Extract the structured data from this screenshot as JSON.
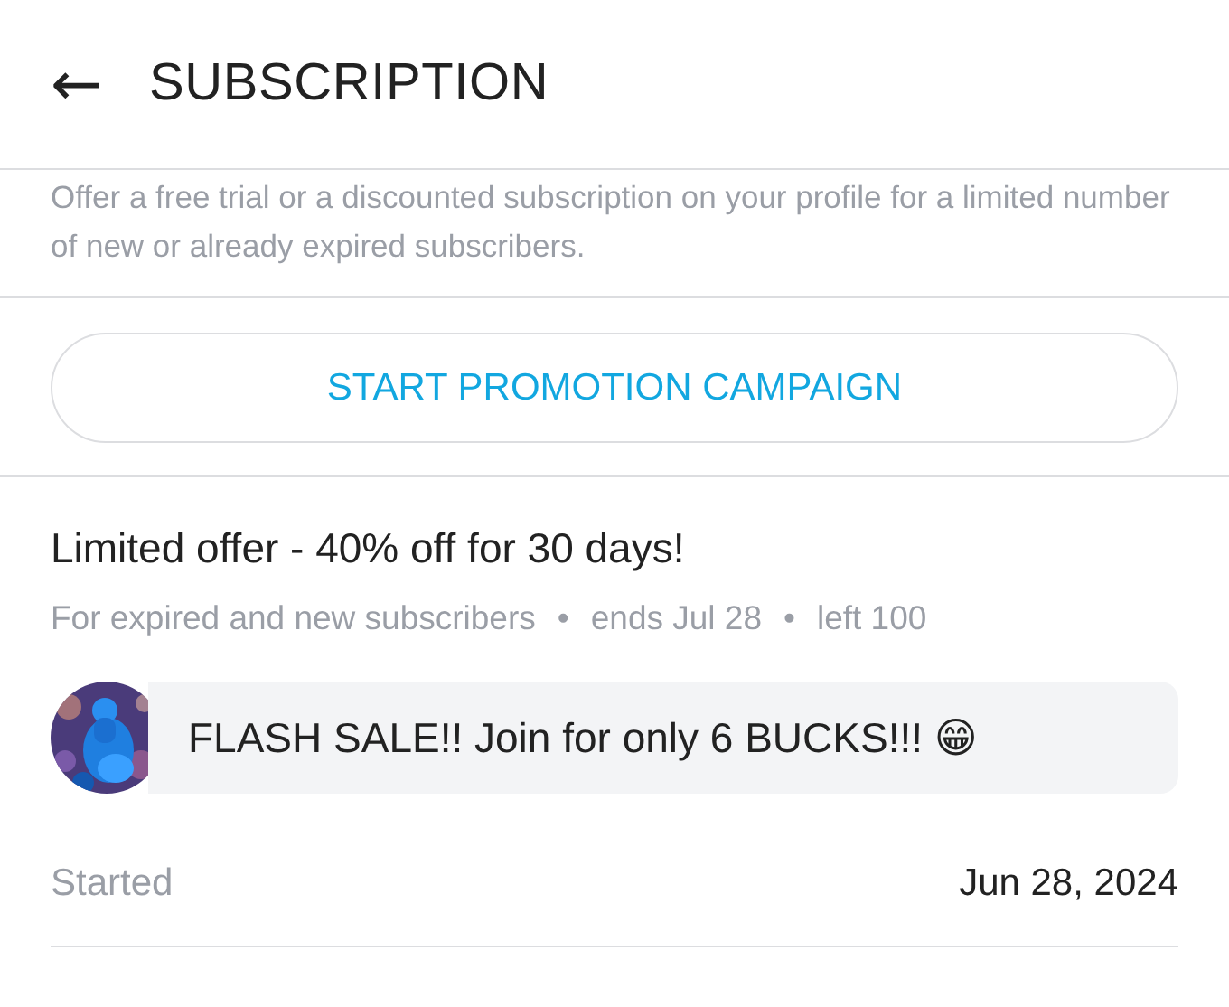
{
  "header": {
    "back_icon": "←",
    "title": "SUBSCRIPTION"
  },
  "description": "Offer a free trial or a discounted subscription on your profile for a limited number of new or already expired subscribers.",
  "promo_button": "START PROMOTION CAMPAIGN",
  "offer": {
    "title": "Limited offer - 40% off for 30 days!",
    "meta": [
      "For expired and new subscribers",
      "ends Jul 28",
      "left 100"
    ],
    "separator": "•",
    "message": "FLASH SALE!! Join for only 6 BUCKS!!! 😁",
    "started_label": "Started",
    "started_value": "Jun 28, 2024"
  }
}
